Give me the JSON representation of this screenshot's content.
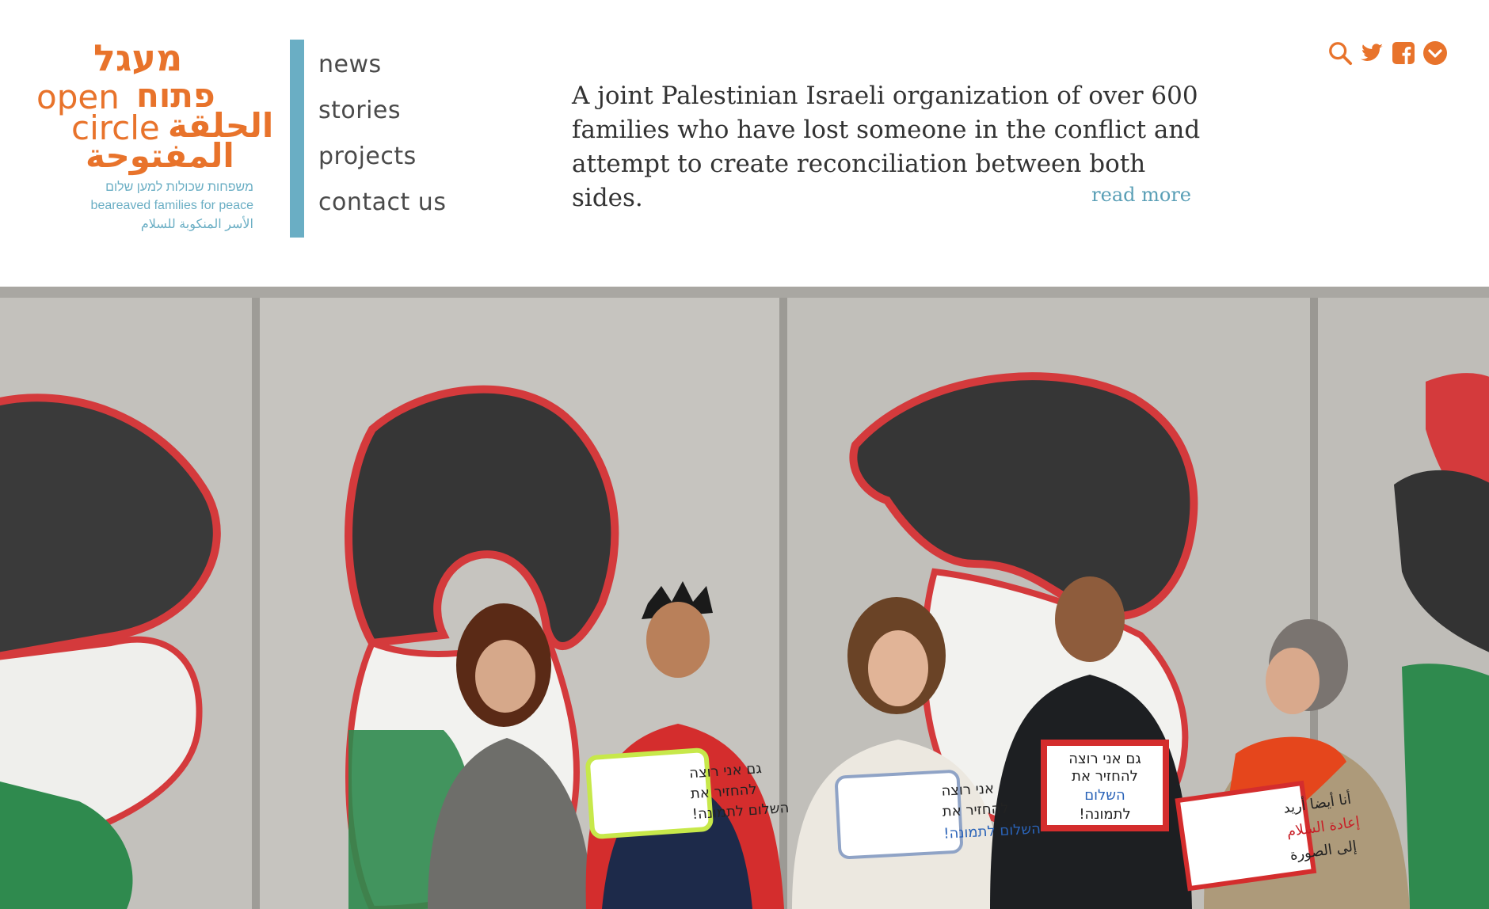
{
  "logo": {
    "hebrew_line1": "מעגל",
    "english_line1": "open",
    "hebrew_line2": "פתוח",
    "english_line2": "circle",
    "arabic_line1": "الحلقة",
    "arabic_line2": "المفتوحة",
    "sub_hebrew": "משפחות שכולות למען שלום",
    "sub_english": "beareaved families for peace",
    "sub_arabic": "الأسر المنكوبة للسلام"
  },
  "nav": {
    "items": [
      {
        "label": "news"
      },
      {
        "label": "stories"
      },
      {
        "label": "projects"
      },
      {
        "label": "contact us"
      }
    ]
  },
  "mission": {
    "text": "A joint Palestinian Israeli organization of over 600 families who have lost someone in the conflict and attempt to create reconciliation between both sides.",
    "read_more": "read more"
  },
  "social": {
    "icons": [
      "search-icon",
      "twitter-icon",
      "facebook-icon",
      "chevron-down-icon"
    ]
  },
  "colors": {
    "brand_orange": "#e8732b",
    "brand_blue": "#6aaec4",
    "text_dark": "#333333"
  },
  "hero": {
    "signs": [
      {
        "line1": "גם אני רוצה",
        "line2": "להחזיר את",
        "line3": "השלום לתמונה!"
      },
      {
        "line1": "אני רוצה",
        "line2": "להחזיר את",
        "line3": "השלום לתמונה!"
      },
      {
        "line1": "גם אני רוצה",
        "line2": "להחזיר את",
        "line3": "השלום",
        "line4": "לתמונה!"
      },
      {
        "line1": "أنا أيضا أريد",
        "line2": "إعادة السلام",
        "line3": "إلى الصورة"
      }
    ]
  }
}
